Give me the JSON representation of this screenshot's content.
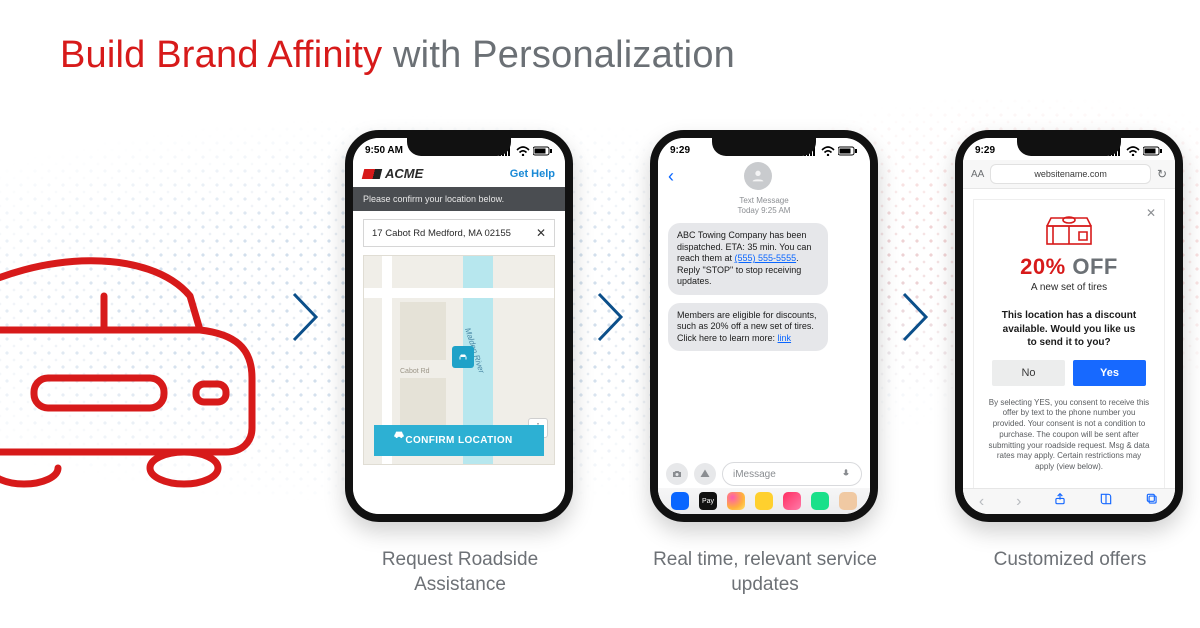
{
  "headline": {
    "red": "Build Brand Affinity",
    "gray": " with Personalization"
  },
  "captions": {
    "phone1": "Request Roadside Assistance",
    "phone2": "Real time, relevant service updates",
    "phone3": "Customized offers"
  },
  "statusbar": {
    "time1": "9:50 AM",
    "time2": "9:29",
    "time3": "9:29"
  },
  "phone1": {
    "brand": "ACME",
    "help": "Get Help",
    "band": "Please confirm your location below.",
    "address": "17 Cabot Rd Medford, MA 02155",
    "river": "Malden River",
    "road": "Cabot Rd",
    "cta": "CONFIRM LOCATION"
  },
  "phone2": {
    "meta_line1": "Text Message",
    "meta_line2": "Today 9:25 AM",
    "msg1_a": "ABC Towing Company has been dispatched. ETA: 35 min. You can reach them at ",
    "msg1_phone": "(555) 555-5555",
    "msg1_b": ". Reply \"STOP\" to stop receiving updates.",
    "msg2_a": "Members are eligible for discounts, such as 20% off a new set of tires. Click here to learn more: ",
    "msg2_link": "link",
    "placeholder": "iMessage",
    "pay": "Pay"
  },
  "phone3": {
    "aa": "AA",
    "url": "websitename.com",
    "pct": "20%",
    "off": " OFF",
    "sub": "A new set of tires",
    "ask": "This location has a discount available. Would you like us to send it to you?",
    "no": "No",
    "yes": "Yes",
    "legal": "By selecting YES, you consent to receive this offer by text to the phone number you provided. Your consent is not a condition to purchase. The coupon will be sent after submitting your roadside request. Msg & data rates may apply. Certain restrictions may apply (view below)."
  }
}
